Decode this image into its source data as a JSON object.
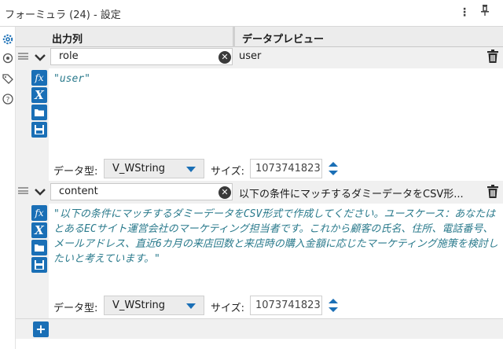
{
  "window": {
    "title": "フォーミュラ (24) - 設定",
    "menu_icon": "more-vertical-icon",
    "pin_icon": "pin-icon"
  },
  "sidebar": {
    "icons": [
      "gear-icon",
      "tool-settings-icon",
      "tag-icon",
      "help-icon"
    ],
    "accent": "#1a6fb6"
  },
  "grid": {
    "header": {
      "output_column": "出力列",
      "data_preview": "データプレビュー"
    },
    "rows": [
      {
        "name": "role",
        "preview": "user",
        "expression": "\"user\"",
        "type_label": "データ型:",
        "type_value": "V_WString",
        "size_label": "サイズ:",
        "size_value": "1073741823"
      },
      {
        "name": "content",
        "preview": "以下の条件にマッチするダミーデータをCSV形...",
        "expression": "\"以下の条件にマッチするダミーデータをCSV形式で作成してください。ユースケース：あなたはとあるECサイト運営会社のマーケティング担当者です。これから顧客の氏名、住所、電話番号、メールアドレス、直近6カ月の来店回数と来店時の購入金額に応じたマーケティング施策を検討したいと考えています。\"",
        "type_label": "データ型:",
        "type_value": "V_WString",
        "size_label": "サイズ:",
        "size_value": "1073741823"
      }
    ],
    "tool_icons": [
      "fx-icon",
      "variable-x-icon",
      "open-folder-icon",
      "save-icon"
    ],
    "add_icon": "plus-icon"
  },
  "colors": {
    "accent_blue": "#1a6fb6",
    "expression_text": "#2a7a8c"
  }
}
